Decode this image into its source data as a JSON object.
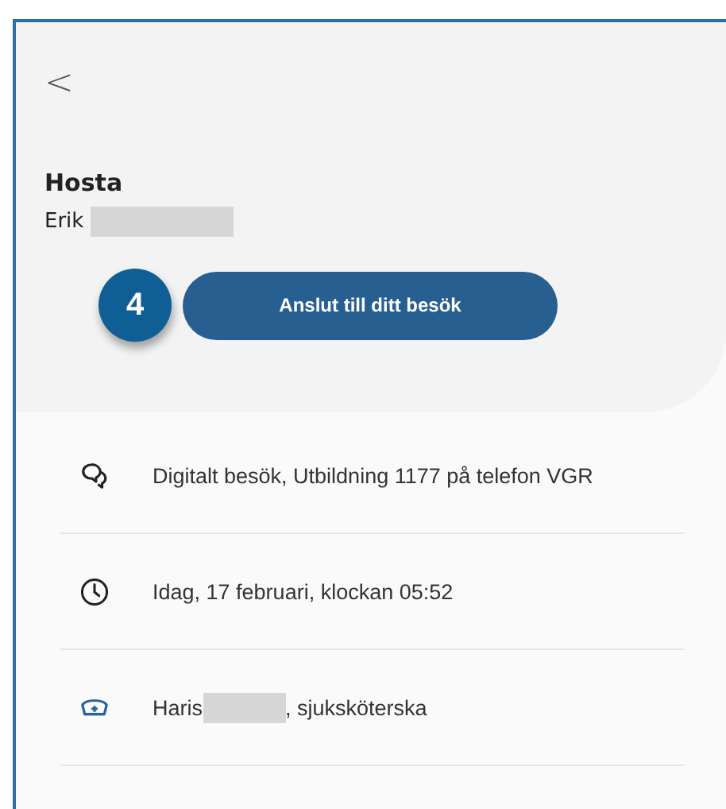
{
  "header": {
    "back": "<",
    "title": "Hosta",
    "patient": {
      "name": "Erik",
      "redacted": true
    }
  },
  "step_badge": "4",
  "button": "Anslut till ditt besök",
  "details": [
    {
      "kind": "chat",
      "text": "Digitalt besök, Utbildning 1177 på telefon VGR"
    },
    {
      "kind": "clock",
      "text": "Idag, 17 februari, klockan 05:52"
    },
    {
      "kind": "nurse",
      "text": "Haris",
      "redacted": true,
      "text_after": ", sjuksköterska"
    }
  ]
}
